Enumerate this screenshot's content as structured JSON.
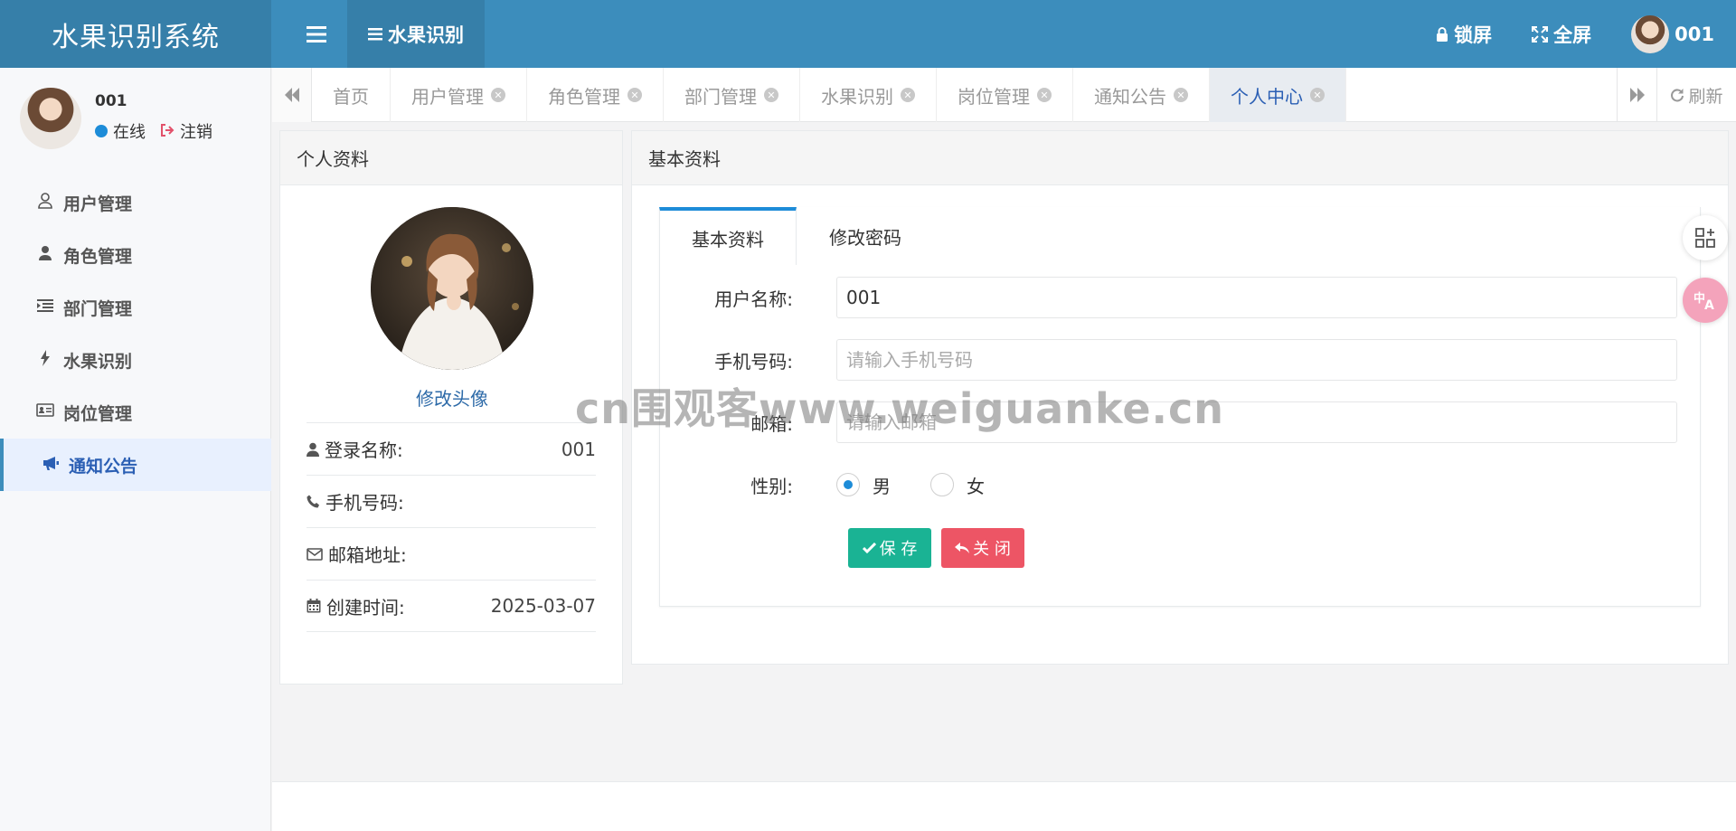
{
  "header": {
    "brand": "水果识别系统",
    "active_nav": "水果识别",
    "lock": "锁屏",
    "fullscreen": "全屏",
    "user": "001"
  },
  "sidebar": {
    "user_name": "001",
    "status": "在线",
    "logout": "注销",
    "items": [
      {
        "label": "用户管理",
        "icon": "user-icon"
      },
      {
        "label": "角色管理",
        "icon": "role-icon"
      },
      {
        "label": "部门管理",
        "icon": "indent-icon"
      },
      {
        "label": "水果识别",
        "icon": "bolt-icon"
      },
      {
        "label": "岗位管理",
        "icon": "id-card-icon"
      },
      {
        "label": "通知公告",
        "icon": "bullhorn-icon",
        "active": true
      }
    ]
  },
  "tabs": {
    "items": [
      "首页",
      "用户管理",
      "角色管理",
      "部门管理",
      "水果识别",
      "岗位管理",
      "通知公告",
      "个人中心"
    ],
    "active": "个人中心",
    "refresh": "刷新"
  },
  "profile": {
    "title": "个人资料",
    "change_avatar": "修改头像",
    "rows": [
      {
        "label": "登录名称:",
        "value": "001",
        "icon": "user-icon"
      },
      {
        "label": "手机号码:",
        "value": "",
        "icon": "phone-icon"
      },
      {
        "label": "邮箱地址:",
        "value": "",
        "icon": "envelope-icon"
      },
      {
        "label": "创建时间:",
        "value": "2025-03-07",
        "icon": "calendar-icon"
      }
    ]
  },
  "basic": {
    "title": "基本资料",
    "tab_basic": "基本资料",
    "tab_password": "修改密码",
    "username_label": "用户名称:",
    "username_value": "001",
    "phone_label": "手机号码:",
    "phone_placeholder": "请输入手机号码",
    "email_label": "邮箱:",
    "email_placeholder": "请输入邮箱",
    "gender_label": "性别:",
    "gender_male": "男",
    "gender_female": "女",
    "save": "保 存",
    "close": "关 闭"
  },
  "watermark": "cn围观客www.weiguanke.cn",
  "colors": {
    "header": "#3c8dbc",
    "save": "#1ab394",
    "close": "#ed5565",
    "accent": "#1d8cd8"
  }
}
